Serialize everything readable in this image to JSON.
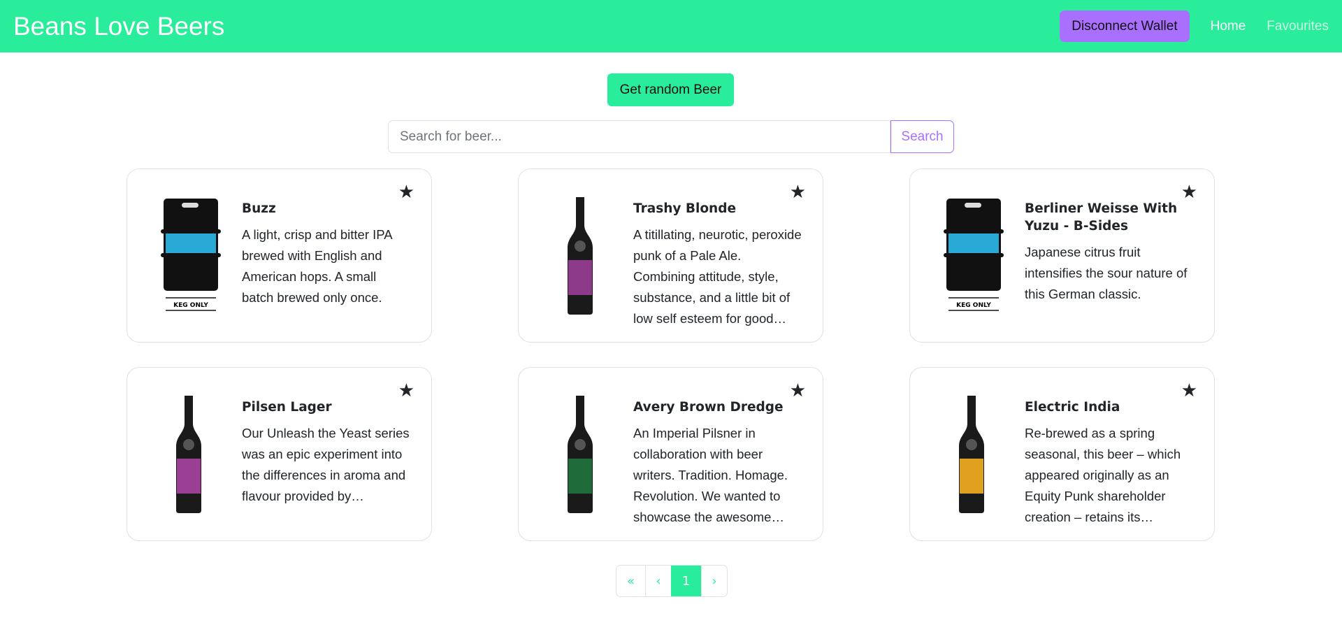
{
  "nav": {
    "brand": "Beans Love Beers",
    "wallet_button": "Disconnect Wallet",
    "links": [
      "Home",
      "Favourites"
    ]
  },
  "random_button": "Get random Beer",
  "search": {
    "placeholder": "Search for beer...",
    "value": "",
    "button": "Search"
  },
  "beers": [
    {
      "name": "Buzz",
      "description": "A light, crisp and bitter IPA brewed with English and American hops. A small batch brewed only once.",
      "image": "keg",
      "label_color": "#29a9d6",
      "keg_text": "KEG ONLY",
      "favourite_icon": "star-icon"
    },
    {
      "name": "Trashy Blonde",
      "description": "A titillating, neurotic, peroxide punk of a Pale Ale. Combining attitude, style, substance, and a little bit of low self esteem for good…",
      "image": "bottle",
      "label_color": "#8e3a8a",
      "favourite_icon": "star-icon"
    },
    {
      "name": "Berliner Weisse With Yuzu - B-Sides",
      "description": "Japanese citrus fruit intensifies the sour nature of this German classic.",
      "image": "keg",
      "label_color": "#29a9d6",
      "keg_text": "KEG ONLY",
      "favourite_icon": "star-icon"
    },
    {
      "name": "Pilsen Lager",
      "description": "Our Unleash the Yeast series was an epic experiment into the differences in aroma and flavour provided by…",
      "image": "bottle",
      "label_color": "#9b3f94",
      "favourite_icon": "star-icon"
    },
    {
      "name": "Avery Brown Dredge",
      "description": "An Imperial Pilsner in collaboration with beer writers. Tradition. Homage. Revolution. We wanted to showcase the awesome…",
      "image": "bottle",
      "label_color": "#1f6b3a",
      "favourite_icon": "star-icon"
    },
    {
      "name": "Electric India",
      "description": "Re-brewed as a spring seasonal, this beer – which appeared originally as an Equity Punk shareholder creation – retains its…",
      "image": "bottle",
      "label_color": "#e0a020",
      "favourite_icon": "star-icon"
    }
  ],
  "pagination": {
    "first": "«",
    "prev": "‹",
    "current": "1",
    "next": "›"
  }
}
